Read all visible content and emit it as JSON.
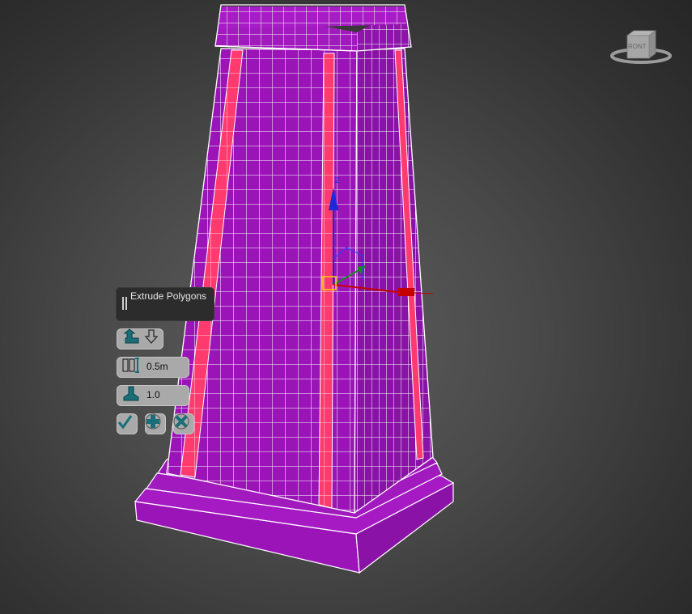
{
  "caddy": {
    "title": "Extrude Polygons",
    "height_value": "0.5m",
    "outline_value": "1.0",
    "icons": {
      "grip": "grip-icon",
      "extrusion_type": "extrusion-type-icon",
      "height": "height-icon",
      "outline": "outline-icon",
      "ok": "checkmark-icon",
      "apply": "plus-icon",
      "cancel": "x-icon"
    }
  },
  "viewcube": {
    "face_label": "RONT"
  },
  "gizmo": {
    "z_label": "Z"
  },
  "colors": {
    "mesh": "#9b14b8",
    "mesh_side": "#8a12a6",
    "wire": "#ffffff",
    "selected_faces": "#ff3a6e",
    "gizmo_z": "#1a2ad8",
    "gizmo_y": "#1a8a1a",
    "gizmo_x": "#c40000"
  }
}
